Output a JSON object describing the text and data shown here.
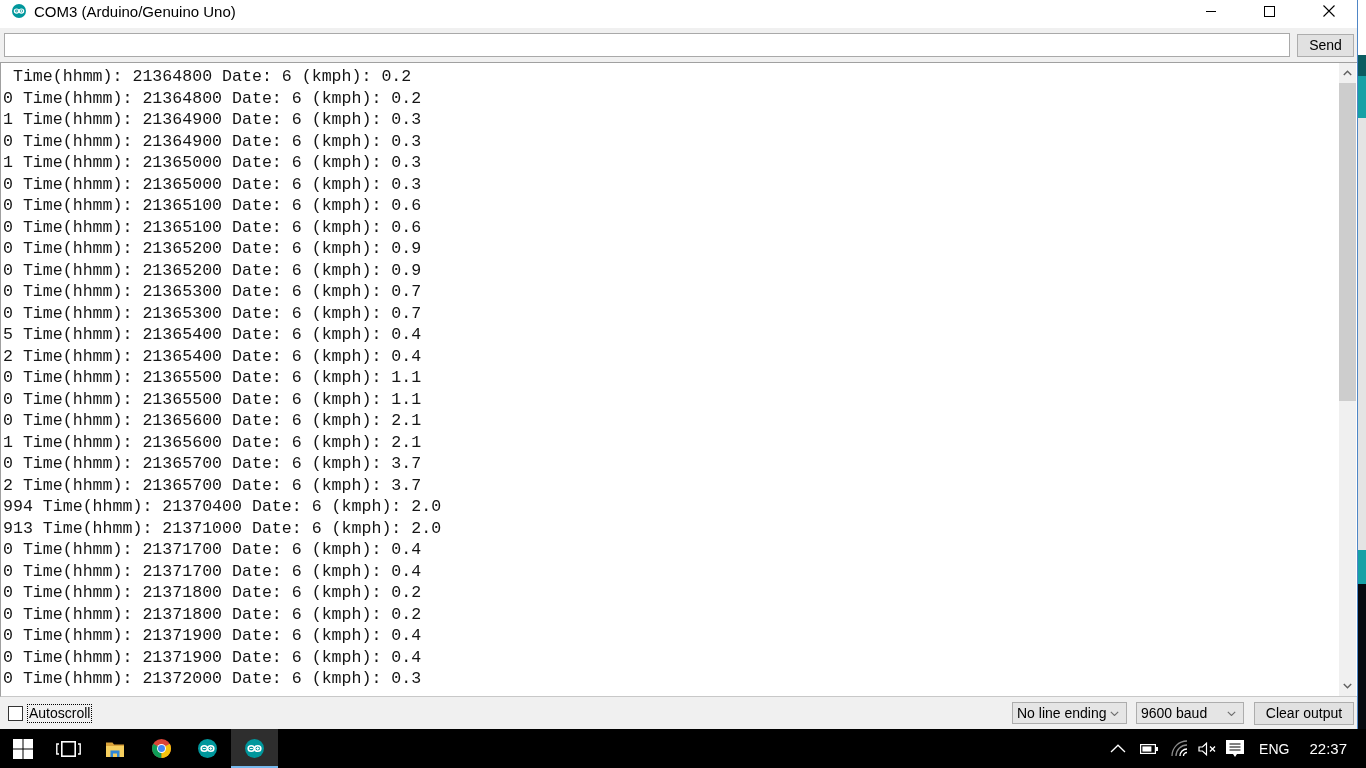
{
  "window": {
    "title": "COM3 (Arduino/Genuino Uno)"
  },
  "send_bar": {
    "button": "Send"
  },
  "output": {
    "lines": [
      " Time(hhmm): 21364800 Date: 6 (kmph): 0.2",
      "0 Time(hhmm): 21364800 Date: 6 (kmph): 0.2",
      "1 Time(hhmm): 21364900 Date: 6 (kmph): 0.3",
      "0 Time(hhmm): 21364900 Date: 6 (kmph): 0.3",
      "1 Time(hhmm): 21365000 Date: 6 (kmph): 0.3",
      "0 Time(hhmm): 21365000 Date: 6 (kmph): 0.3",
      "0 Time(hhmm): 21365100 Date: 6 (kmph): 0.6",
      "0 Time(hhmm): 21365100 Date: 6 (kmph): 0.6",
      "0 Time(hhmm): 21365200 Date: 6 (kmph): 0.9",
      "0 Time(hhmm): 21365200 Date: 6 (kmph): 0.9",
      "0 Time(hhmm): 21365300 Date: 6 (kmph): 0.7",
      "0 Time(hhmm): 21365300 Date: 6 (kmph): 0.7",
      "5 Time(hhmm): 21365400 Date: 6 (kmph): 0.4",
      "2 Time(hhmm): 21365400 Date: 6 (kmph): 0.4",
      "0 Time(hhmm): 21365500 Date: 6 (kmph): 1.1",
      "0 Time(hhmm): 21365500 Date: 6 (kmph): 1.1",
      "0 Time(hhmm): 21365600 Date: 6 (kmph): 2.1",
      "1 Time(hhmm): 21365600 Date: 6 (kmph): 2.1",
      "0 Time(hhmm): 21365700 Date: 6 (kmph): 3.7",
      "2 Time(hhmm): 21365700 Date: 6 (kmph): 3.7",
      "994 Time(hhmm): 21370400 Date: 6 (kmph): 2.0",
      "913 Time(hhmm): 21371000 Date: 6 (kmph): 2.0",
      "0 Time(hhmm): 21371700 Date: 6 (kmph): 0.4",
      "0 Time(hhmm): 21371700 Date: 6 (kmph): 0.4",
      "0 Time(hhmm): 21371800 Date: 6 (kmph): 0.2",
      "0 Time(hhmm): 21371800 Date: 6 (kmph): 0.2",
      "0 Time(hhmm): 21371900 Date: 6 (kmph): 0.4",
      "0 Time(hhmm): 21371900 Date: 6 (kmph): 0.4",
      "0 Time(hhmm): 21372000 Date: 6 (kmph): 0.3"
    ]
  },
  "bottom_bar": {
    "autoscroll": {
      "label": "Autoscroll",
      "checked": false,
      "focused": true
    },
    "line_ending": "No line ending",
    "baud_rate": "9600 baud",
    "clear_button": "Clear output"
  },
  "taskbar": {
    "apps": [
      {
        "kind": "start",
        "active": false
      },
      {
        "kind": "task-view",
        "active": false
      },
      {
        "kind": "file-explorer",
        "active": false
      },
      {
        "kind": "chrome",
        "active": false
      },
      {
        "kind": "arduino",
        "active": false
      },
      {
        "kind": "arduino",
        "active": true
      }
    ],
    "tray": {
      "language": "ENG",
      "time": "22:37"
    }
  }
}
